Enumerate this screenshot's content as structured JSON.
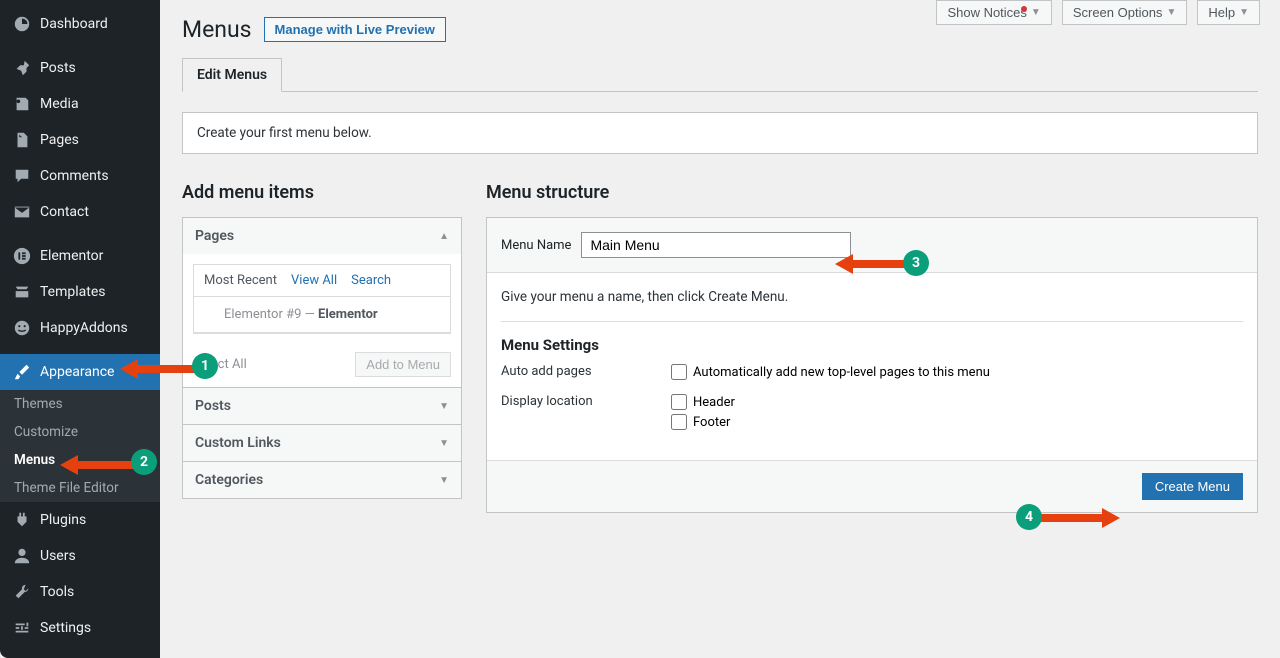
{
  "topbar": {
    "show_notices": "Show Notices",
    "screen_options": "Screen Options",
    "help": "Help"
  },
  "sidebar": {
    "dashboard": "Dashboard",
    "posts": "Posts",
    "media": "Media",
    "pages": "Pages",
    "comments": "Comments",
    "contact": "Contact",
    "elementor": "Elementor",
    "templates": "Templates",
    "happyaddons": "HappyAddons",
    "appearance": "Appearance",
    "plugins": "Plugins",
    "users": "Users",
    "tools": "Tools",
    "settings": "Settings",
    "sub": {
      "themes": "Themes",
      "customize": "Customize",
      "menus": "Menus",
      "theme_file_editor": "Theme File Editor"
    }
  },
  "page": {
    "title": "Menus",
    "preview_btn": "Manage with Live Preview",
    "tab_edit": "Edit Menus",
    "info": "Create your first menu below."
  },
  "add_items": {
    "heading": "Add menu items",
    "pages": "Pages",
    "posts": "Posts",
    "custom_links": "Custom Links",
    "categories": "Categories",
    "tab_most_recent": "Most Recent",
    "tab_view_all": "View All",
    "tab_search": "Search",
    "page_item_prefix": "Elementor #9 — ",
    "page_item_strong": "Elementor",
    "select_all": "Select All",
    "add_to_menu": "Add to Menu"
  },
  "structure": {
    "heading": "Menu structure",
    "name_label": "Menu Name",
    "name_value": "Main Menu",
    "instruction": "Give your menu a name, then click Create Menu.",
    "settings_heading": "Menu Settings",
    "auto_add_label": "Auto add pages",
    "auto_add_text": "Automatically add new top-level pages to this menu",
    "display_loc_label": "Display location",
    "loc_header": "Header",
    "loc_footer": "Footer",
    "create_btn": "Create Menu"
  },
  "annotations": {
    "b1": "1",
    "b2": "2",
    "b3": "3",
    "b4": "4"
  }
}
